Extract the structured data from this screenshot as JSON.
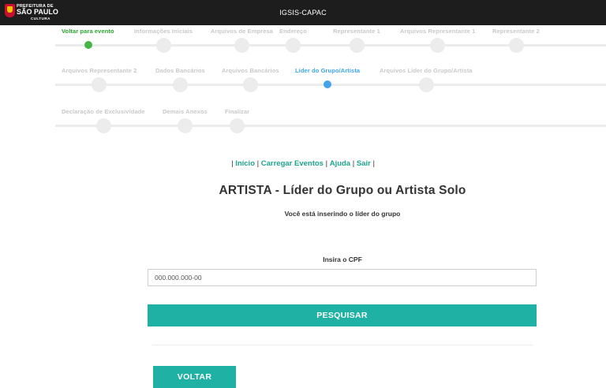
{
  "header": {
    "logo_line1": "PREFEITURA DE",
    "logo_line2": "SÃO PAULO",
    "logo_line3": "CULTURA",
    "title": "IGSIS-CAPAC"
  },
  "wizard": {
    "rows": [
      [
        {
          "label": "Voltar para evento",
          "state": "done"
        },
        {
          "label": "Informações Iniciais",
          "state": "pending"
        },
        {
          "label": "Arquivos de Empresa",
          "state": "pending"
        },
        {
          "label": "Endereço",
          "state": "pending"
        },
        {
          "label": "Representante 1",
          "state": "pending"
        },
        {
          "label": "Arquivos Representante 1",
          "state": "pending"
        },
        {
          "label": "Representante 2",
          "state": "pending"
        }
      ],
      [
        {
          "label": "Arquivos Representante 2",
          "state": "pending"
        },
        {
          "label": "Dados Bancários",
          "state": "pending"
        },
        {
          "label": "Arquivos Bancários",
          "state": "pending"
        },
        {
          "label": "Líder do Grupo/Artista",
          "state": "active"
        },
        {
          "label": "Arquivos Líder do Grupo/Artista",
          "state": "pending"
        }
      ],
      [
        {
          "label": "Declaração de Exclusividade",
          "state": "pending"
        },
        {
          "label": "Demais Anexos",
          "state": "pending"
        },
        {
          "label": "Finalizar",
          "state": "pending"
        }
      ]
    ]
  },
  "nav_links": [
    "Início",
    "Carregar Eventos",
    "Ajuda",
    "Sair"
  ],
  "main": {
    "title": "ARTISTA - Líder do Grupo ou Artista Solo",
    "subtitle": "Você está inserindo o líder do grupo",
    "cpf_label": "Insira o CPF",
    "cpf_placeholder": "000.000.000-00",
    "cpf_value": "",
    "search_button": "PESQUISAR",
    "back_button": "VOLTAR"
  },
  "colors": {
    "accent": "#1fb1a4",
    "link": "#1ea48d",
    "done": "#43b647",
    "active": "#45a3ea",
    "pending": "#ececec",
    "topbar": "#1d1d1d"
  }
}
